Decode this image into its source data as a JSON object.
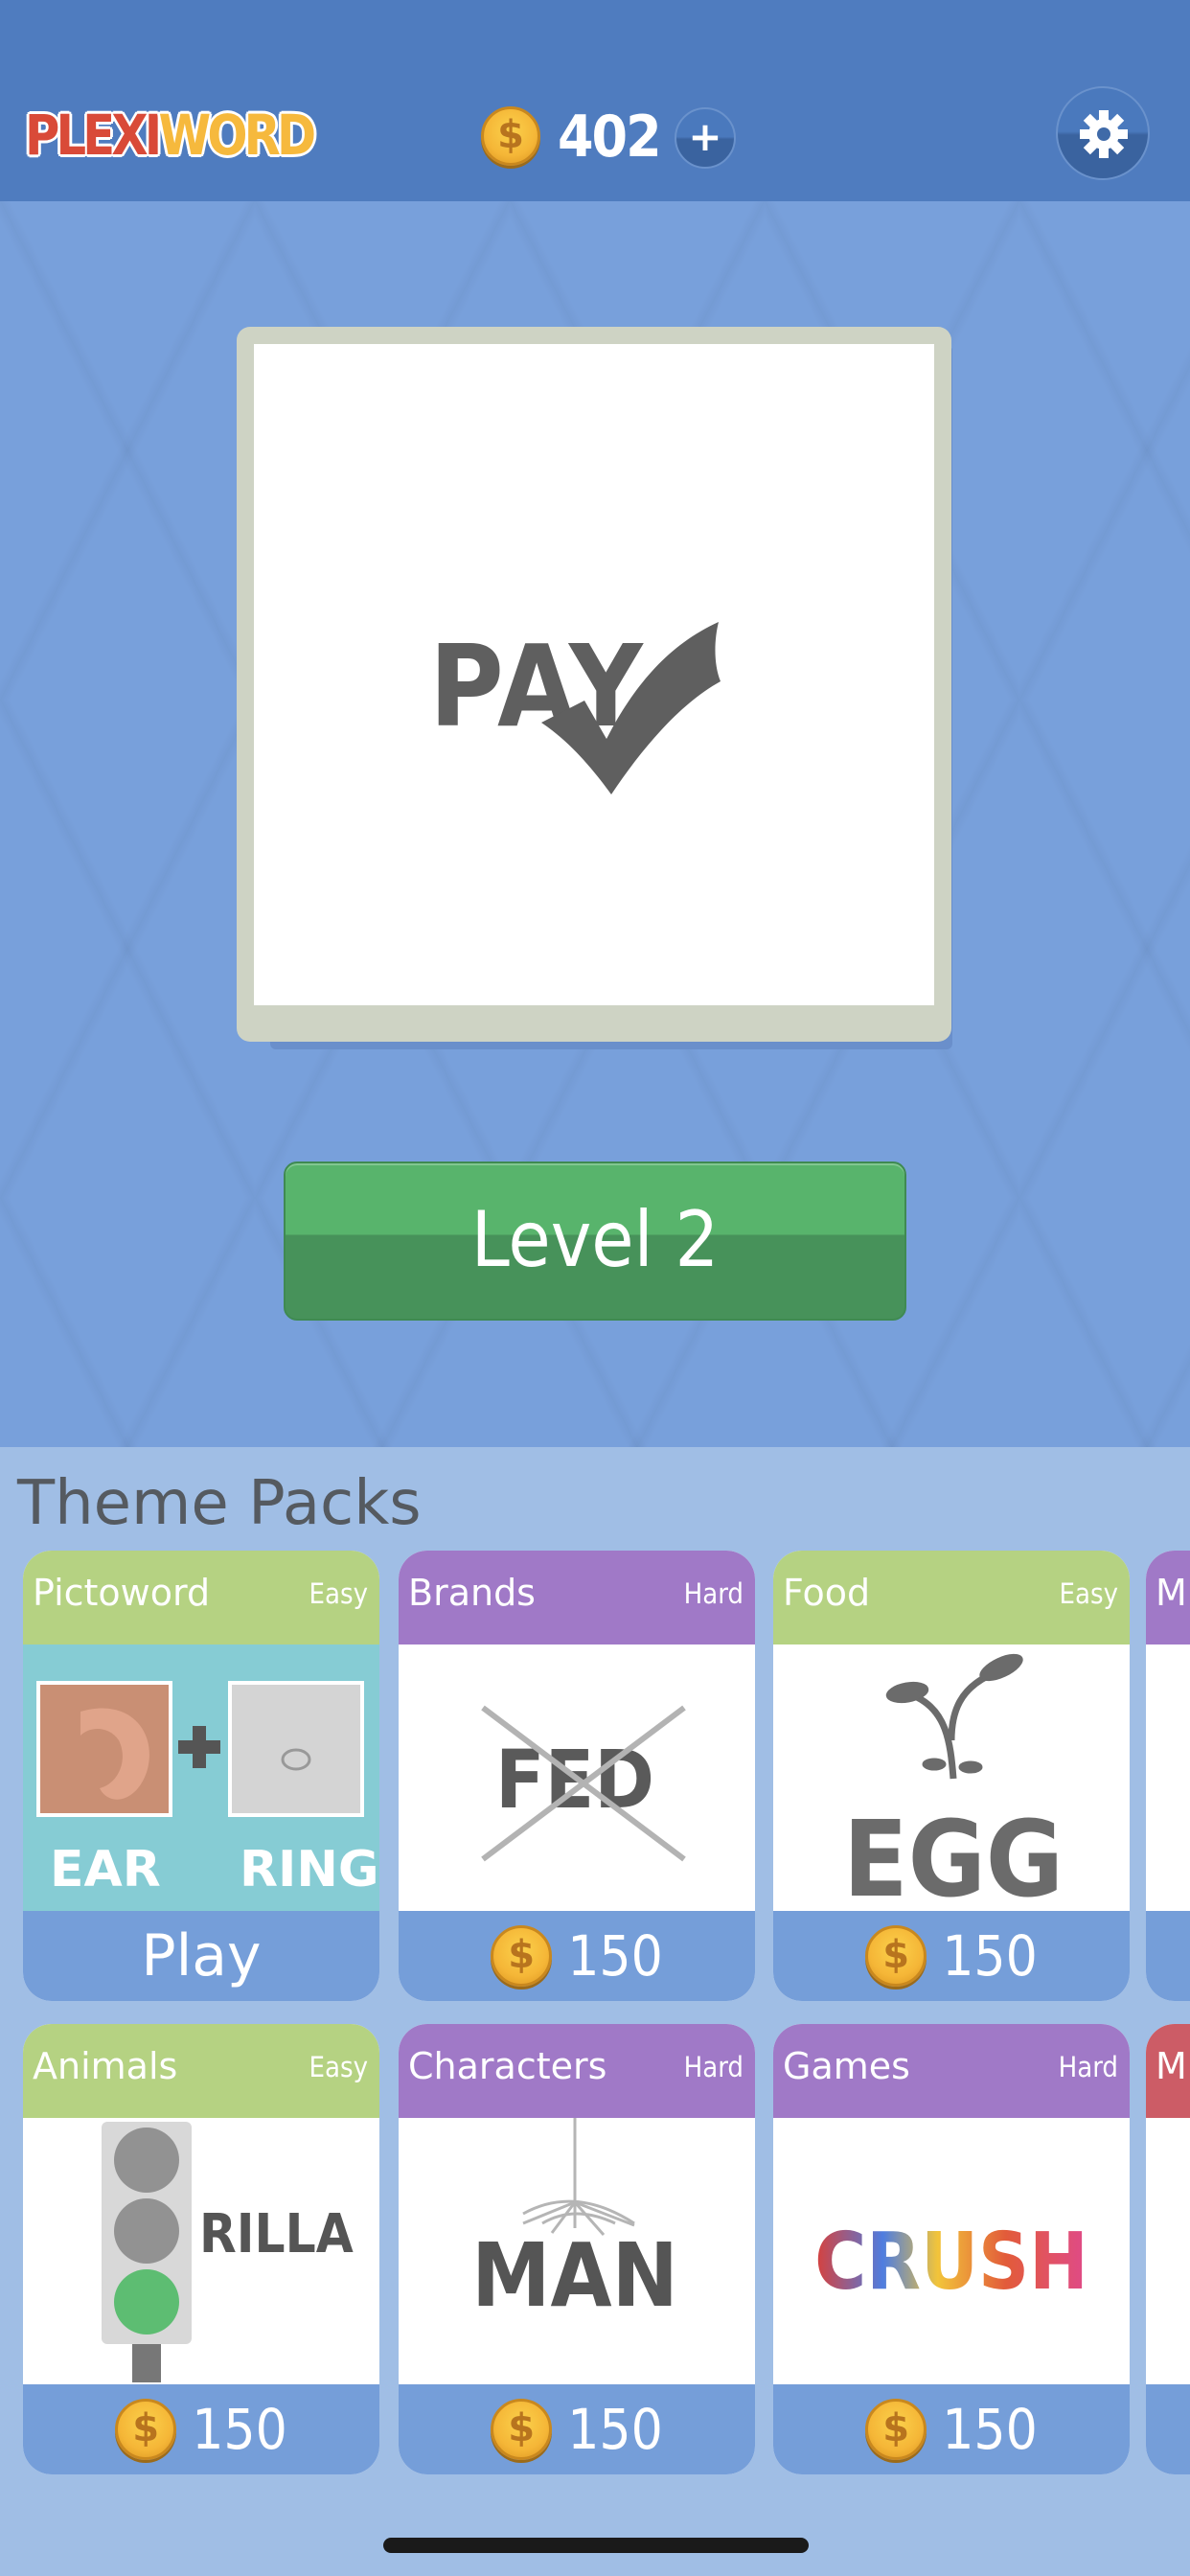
{
  "header": {
    "logo_part1": "PLEXI",
    "logo_part2": "WORD",
    "coin_balance": "402",
    "add_coins_label": "+",
    "settings_icon": "gear-icon"
  },
  "puzzle": {
    "text": "PAY",
    "symbol": "checkmark"
  },
  "level_button": {
    "label": "Level 2"
  },
  "theme_packs": {
    "title": "Theme Packs",
    "packs": [
      {
        "name": "Pictoword",
        "difficulty": "Easy",
        "action": "Play",
        "preview": [
          "EAR",
          "RING"
        ]
      },
      {
        "name": "Brands",
        "difficulty": "Hard",
        "price": "150",
        "preview": "FED"
      },
      {
        "name": "Food",
        "difficulty": "Easy",
        "price": "150",
        "preview": "EGG"
      },
      {
        "name": "M",
        "difficulty": "",
        "price": ""
      },
      {
        "name": "Animals",
        "difficulty": "Easy",
        "price": "150",
        "preview": "RILLA"
      },
      {
        "name": "Characters",
        "difficulty": "Hard",
        "price": "150",
        "preview": "MAN"
      },
      {
        "name": "Games",
        "difficulty": "Hard",
        "price": "150",
        "preview": "CRUSH"
      },
      {
        "name": "M",
        "difficulty": "",
        "price": ""
      }
    ]
  },
  "colors": {
    "header": "#4f7cbf",
    "easy": "#b5d282",
    "hard": "#a079c7",
    "level_button": "#58b46c"
  }
}
